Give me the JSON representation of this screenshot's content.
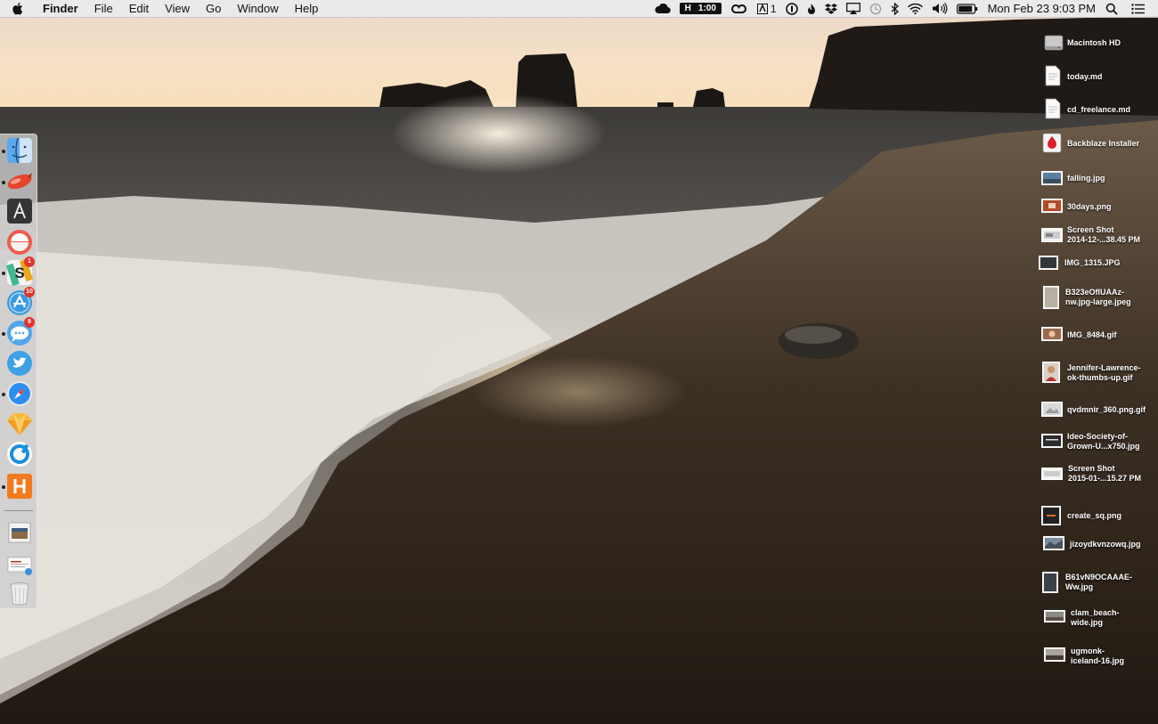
{
  "menubar": {
    "apple_icon": "apple-icon",
    "app_name": "Finder",
    "menus": [
      "File",
      "Edit",
      "View",
      "Go",
      "Window",
      "Help"
    ],
    "timer_prefix": "H",
    "timer_value": "1:00",
    "notification_count": "1",
    "clock": "Mon Feb 23  9:03 PM",
    "status_icons": [
      "cloud-icon",
      "timer-icon",
      "creative-cloud-icon",
      "adobe-icon",
      "one-password-icon",
      "flame-icon",
      "dropbox-icon",
      "airplay-icon",
      "time-machine-icon",
      "bluetooth-icon",
      "wifi-icon",
      "volume-icon",
      "battery-icon",
      "spotlight-icon",
      "notification-center-icon"
    ]
  },
  "dock": {
    "apps": [
      {
        "name": "finder-icon",
        "running": true
      },
      {
        "name": "airmail-icon",
        "running": true
      },
      {
        "name": "text-editor-icon",
        "running": false
      },
      {
        "name": "alarm-icon",
        "running": false
      },
      {
        "name": "slack-icon",
        "running": true,
        "badge": "1"
      },
      {
        "name": "app-store-icon",
        "running": false,
        "badge": "10"
      },
      {
        "name": "messages-icon",
        "running": true,
        "badge": "9"
      },
      {
        "name": "twitter-icon",
        "running": false
      },
      {
        "name": "safari-icon",
        "running": true
      },
      {
        "name": "sketch-icon",
        "running": false
      },
      {
        "name": "music-player-icon",
        "running": false
      },
      {
        "name": "harvest-icon",
        "running": true
      }
    ],
    "items": [
      {
        "name": "downloads-stack-icon"
      },
      {
        "name": "documents-stack-icon"
      },
      {
        "name": "trash-icon"
      }
    ]
  },
  "desktop": [
    {
      "label": "Macintosh HD",
      "kind": "drive"
    },
    {
      "label": "today.md",
      "kind": "doc"
    },
    {
      "label": "cd_freelance.md",
      "kind": "doc"
    },
    {
      "label": "Backblaze Installer",
      "kind": "installer"
    },
    {
      "label": "falling.jpg",
      "kind": "image"
    },
    {
      "label": "30days.png",
      "kind": "image"
    },
    {
      "label": "Screen Shot\n2014-12-...38.45 PM",
      "kind": "image"
    },
    {
      "label": "IMG_1315.JPG",
      "kind": "image"
    },
    {
      "label": "B323eOflUAAz-\nnw.jpg-large.jpeg",
      "kind": "tall"
    },
    {
      "label": "IMG_8484.gif",
      "kind": "image"
    },
    {
      "label": "Jennifer-Lawrence-\nok-thumbs-up.gif",
      "kind": "portrait"
    },
    {
      "label": "qvdmnir_360.png.gif",
      "kind": "image"
    },
    {
      "label": "Ideo-Society-of-\nGrown-U...x750.jpg",
      "kind": "image"
    },
    {
      "label": "Screen Shot\n2015-01-...15.27 PM",
      "kind": "image"
    },
    {
      "label": "create_sq.png",
      "kind": "square"
    },
    {
      "label": "jizoydkvnzowq.jpg",
      "kind": "image"
    },
    {
      "label": "B61vN9OCAAAE-\nWw.jpg",
      "kind": "tall"
    },
    {
      "label": "clam_beach-\nwide.jpg",
      "kind": "image"
    },
    {
      "label": "ugmonk-\niceland-16.jpg",
      "kind": "image"
    }
  ],
  "colors": {
    "sky": "#f3ddc4",
    "sea": "#6f6a64",
    "sand": "#2b2118",
    "foam": "#e9e6e0",
    "menubar": "#ececec",
    "badge": "#e2342c"
  }
}
